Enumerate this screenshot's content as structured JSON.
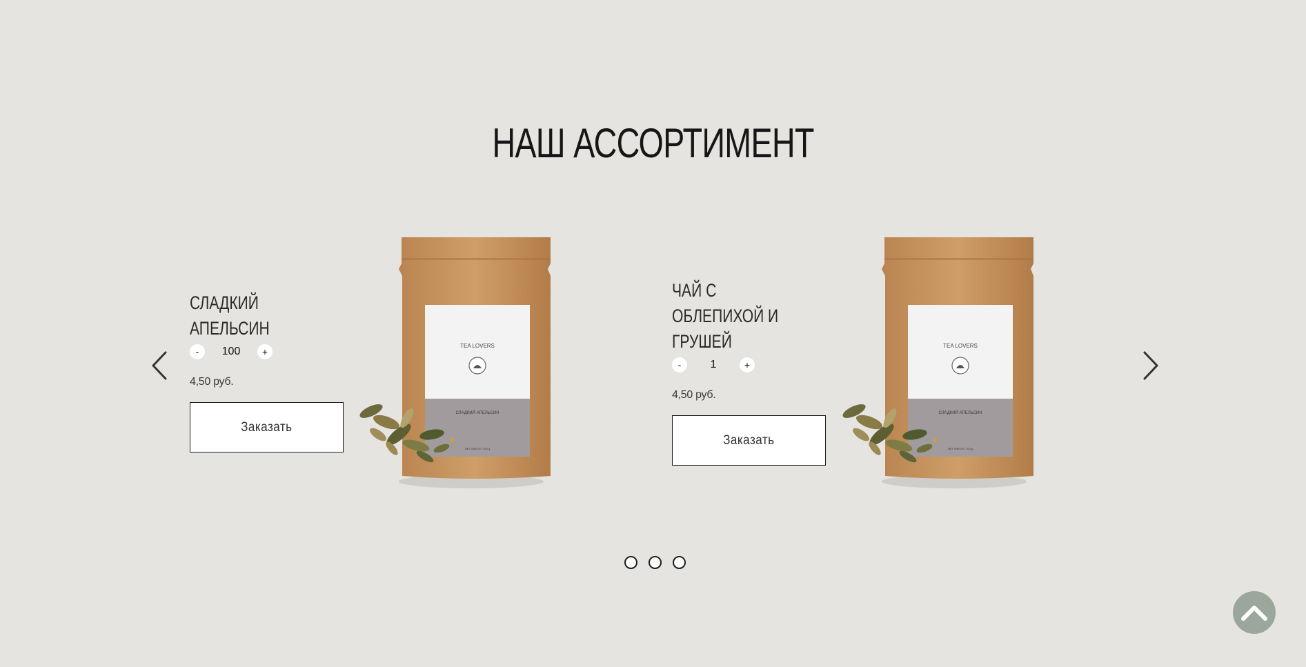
{
  "section": {
    "title": "НАШ АССОРТИМЕНТ"
  },
  "slider": {
    "prev_icon": "chevron-left-icon",
    "next_icon": "chevron-right-icon",
    "pagination_dots": 3
  },
  "products": [
    {
      "name": "Сладкий апельсин",
      "qty_minus": "-",
      "qty": "100",
      "qty_plus": "+",
      "price": "4,50 руб.",
      "order_label": "Заказать",
      "package": {
        "brand": "TEA LOVERS",
        "label_text": "СЛАДКИЙ АПЕЛЬСИН",
        "weight_text": "NET WEIGHT 100 g"
      }
    },
    {
      "name": "Чай с облепихой и грушей",
      "qty_minus": "-",
      "qty": "1",
      "qty_plus": "+",
      "price": "4,50 руб.",
      "order_label": "Заказать",
      "package": {
        "brand": "TEA LOVERS",
        "label_text": "СЛАДКИЙ АПЕЛЬСИН",
        "weight_text": "NET WEIGHT 100 g"
      }
    }
  ],
  "scroll_top": {
    "icon": "chevron-up-icon"
  },
  "colors": {
    "background": "#e5e4e0",
    "kraft": "#c8955d",
    "label": "#f3f3f3",
    "label_band": "#a29b9e",
    "scroll_top_bg": "#9ca79b"
  }
}
